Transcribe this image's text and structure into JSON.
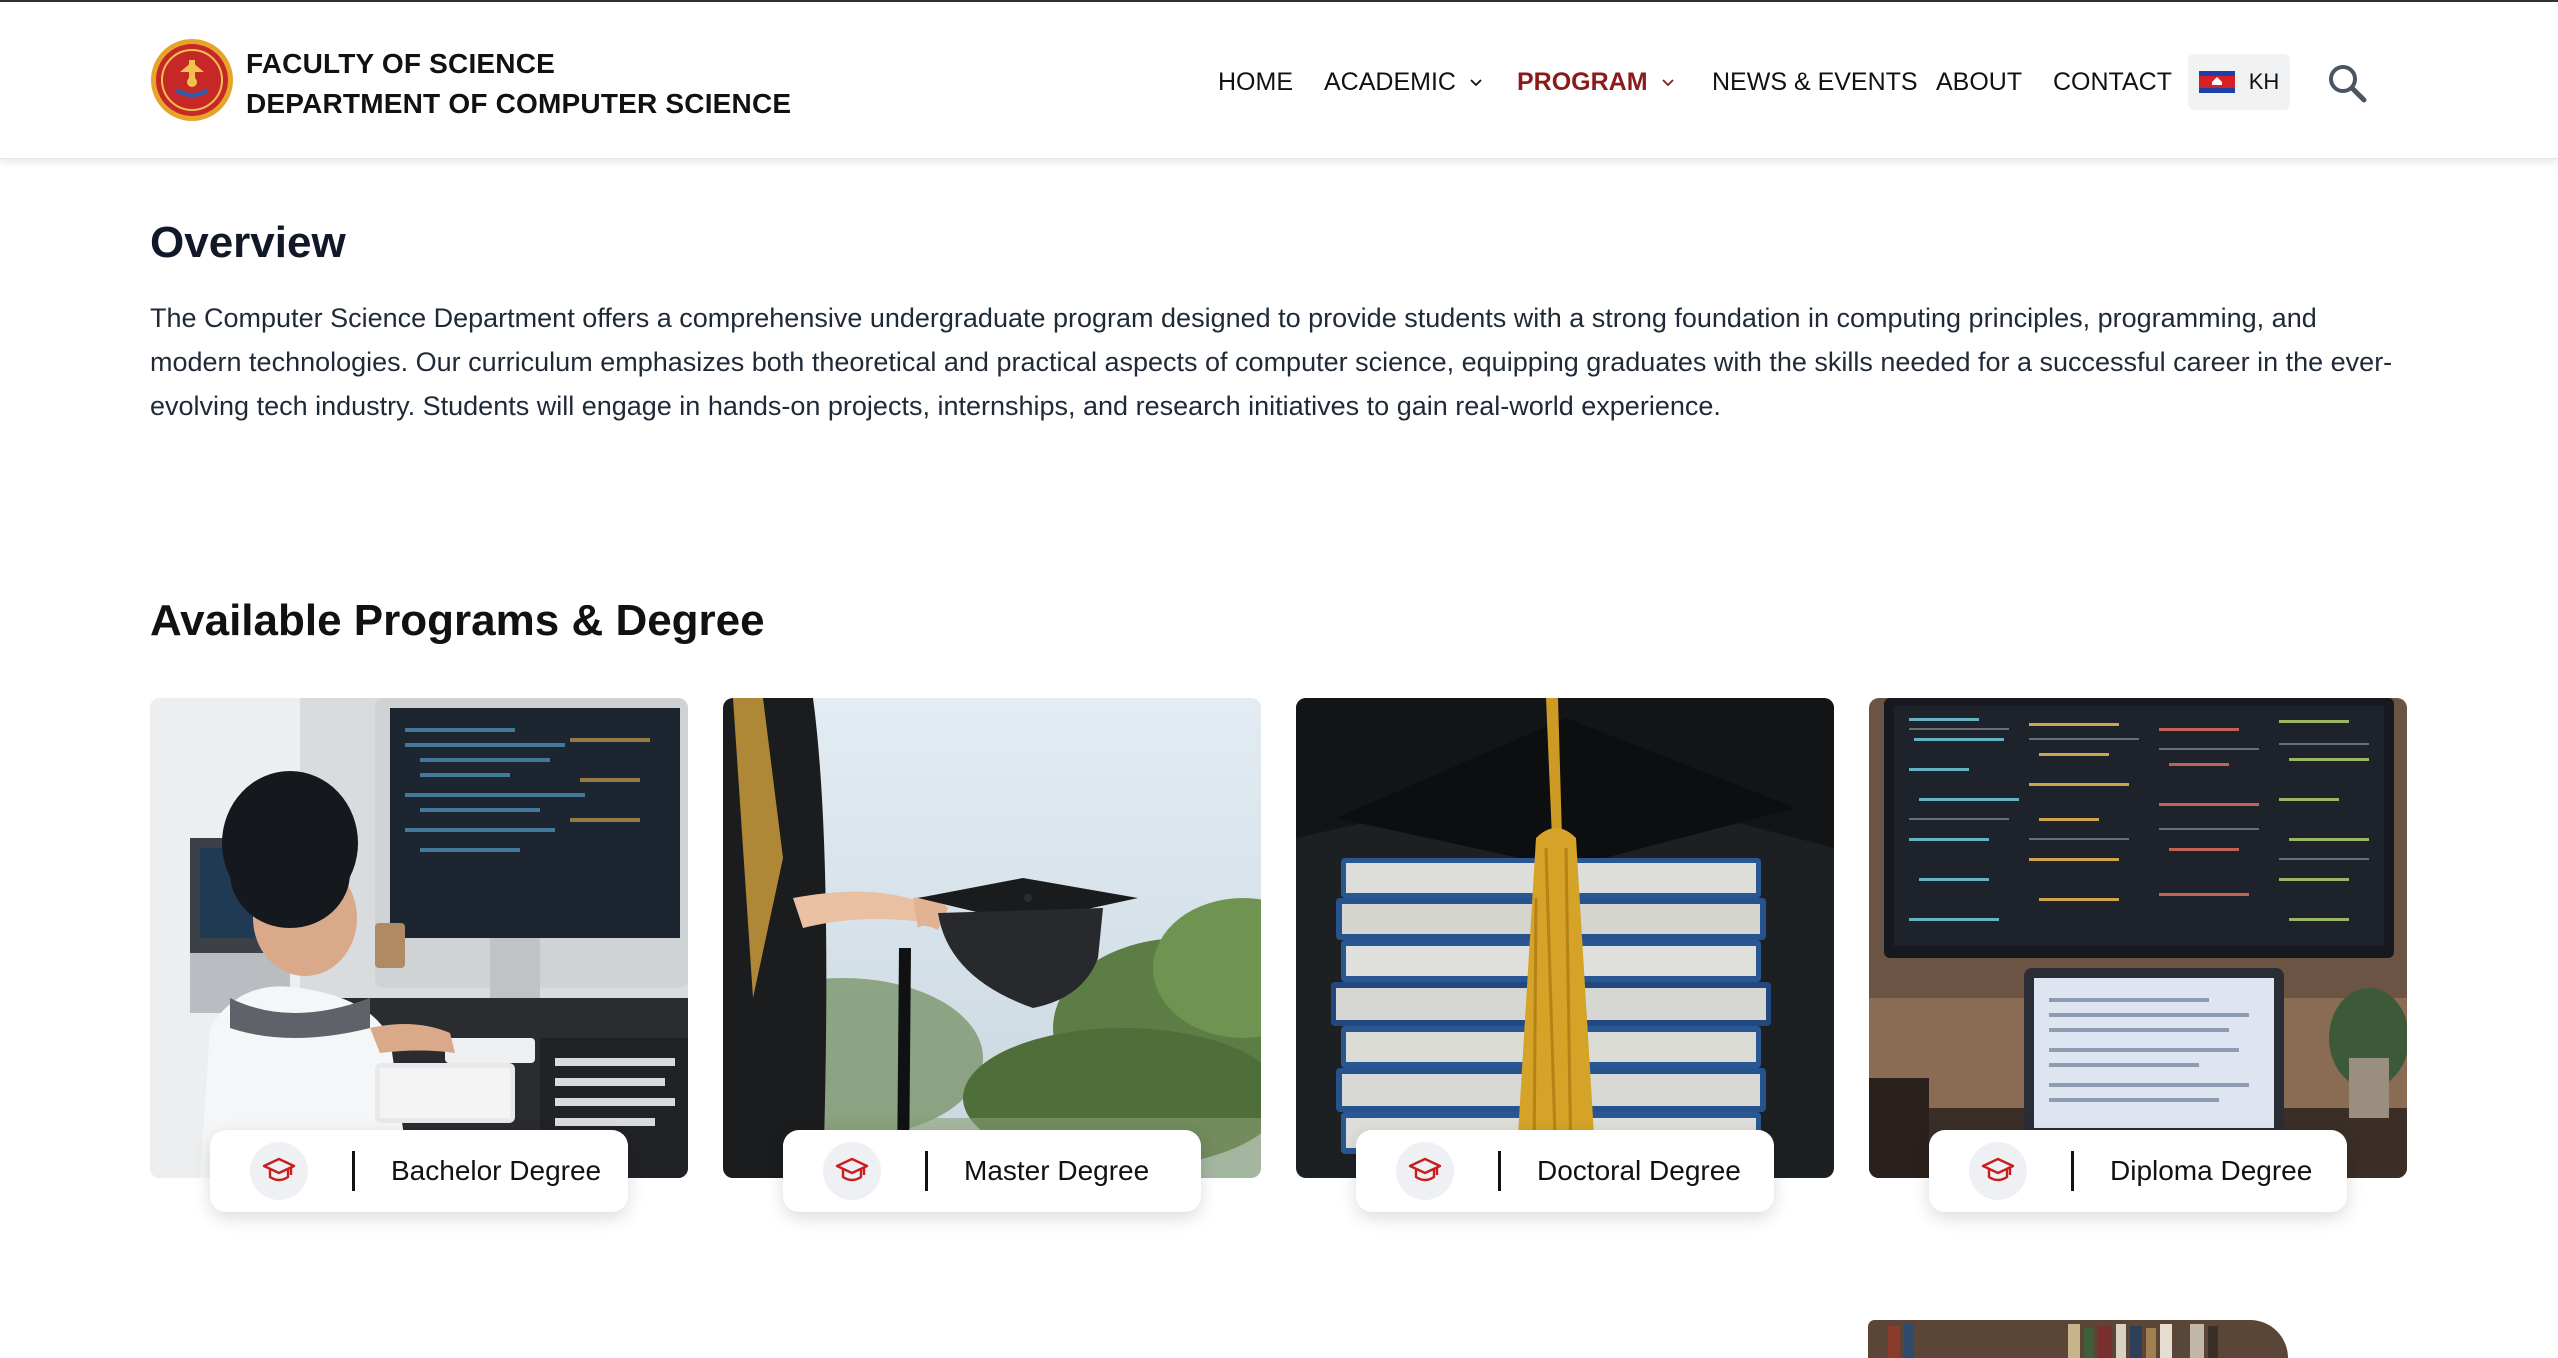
{
  "header": {
    "faculty": "FACULTY OF SCIENCE",
    "department": "DEPARTMENT OF COMPUTER SCIENCE",
    "nav": [
      {
        "label": "HOME",
        "has_dropdown": false,
        "active": false
      },
      {
        "label": "ACADEMIC",
        "has_dropdown": true,
        "active": false
      },
      {
        "label": "PROGRAM",
        "has_dropdown": true,
        "active": true
      },
      {
        "label": "NEWS & EVENTS",
        "has_dropdown": false,
        "active": false
      },
      {
        "label": "ABOUT",
        "has_dropdown": false,
        "active": false
      },
      {
        "label": "CONTACT",
        "has_dropdown": false,
        "active": false
      }
    ],
    "language": "KH",
    "icons": {
      "logo": "university-seal",
      "language": "cambodia-flag-icon",
      "search": "search-icon"
    }
  },
  "overview": {
    "title": "Overview",
    "text": "The Computer Science Department offers a comprehensive undergraduate program designed to provide students with a strong foundation in computing principles, programming, and modern technologies. Our curriculum emphasizes both theoretical and practical aspects of computer science, equipping graduates with the skills needed for a successful career in the ever-evolving tech industry. Students will engage in hands-on projects, internships, and research initiatives to gain real-world experience."
  },
  "programs": {
    "title": "Available Programs & Degree",
    "items": [
      {
        "label": "Bachelor Degree",
        "icon": "graduation-cap-icon",
        "image": "student coding at desktop"
      },
      {
        "label": "Master Degree",
        "icon": "graduation-cap-icon",
        "image": "graduate holding cap"
      },
      {
        "label": "Doctoral Degree",
        "icon": "graduation-cap-icon",
        "image": "books with mortarboard tassel"
      },
      {
        "label": "Diploma Degree",
        "icon": "graduation-cap-icon",
        "image": "code on monitor and laptop"
      }
    ]
  },
  "colors": {
    "accent": "#8b1a1a",
    "icon_red": "#c81e1e",
    "text": "#111827"
  }
}
